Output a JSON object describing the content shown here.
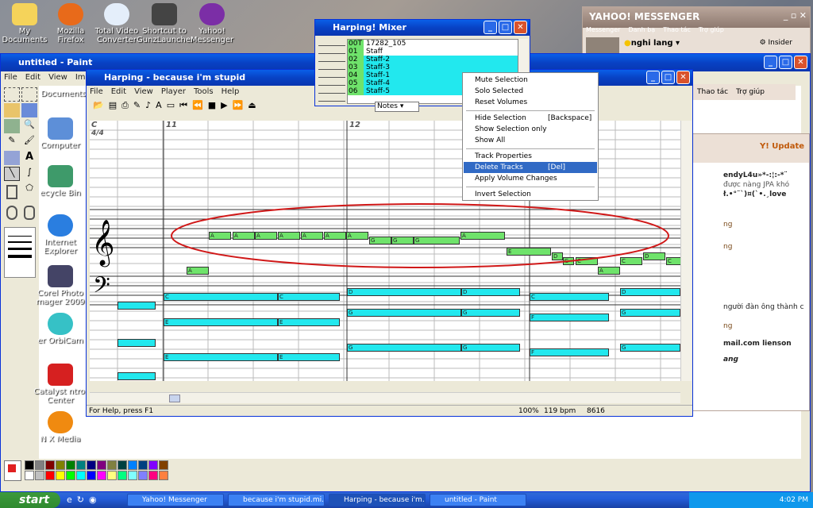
{
  "desktop_icons": [
    {
      "label": "My Documents"
    },
    {
      "label": "Mozilla Firefox"
    },
    {
      "label": "Total Video Converter"
    },
    {
      "label": "Shortcut to GunzLauncher"
    },
    {
      "label": "Yahoo! Messenger"
    }
  ],
  "left_icons": [
    {
      "label": "Documents"
    },
    {
      "label": "Computer"
    },
    {
      "label": "ecycle Bin"
    },
    {
      "label": "Internet Explorer"
    },
    {
      "label": "Corel Photo mager 2009"
    },
    {
      "label": "er OrbiCam"
    },
    {
      "label": "Catalyst ntrol Center"
    },
    {
      "label": "N X Media"
    }
  ],
  "paint": {
    "title": "untitled - Paint",
    "menu": [
      "File",
      "Edit",
      "View",
      "Image"
    ]
  },
  "harping": {
    "title": "Harping - because i'm stupid",
    "menu": [
      "File",
      "Edit",
      "View",
      "Player",
      "Tools",
      "Help"
    ],
    "measures": [
      "11",
      "12"
    ],
    "clef_label": "C",
    "time_sig": "4/4",
    "status": "For Help, press F1",
    "zoom": "100%",
    "bpm": "119 bpm",
    "pos": "8616",
    "notes_select": "Notes"
  },
  "mixer": {
    "title": "Harping! Mixer",
    "tracks": [
      {
        "num": "00T",
        "name": "17282_105"
      },
      {
        "num": "01",
        "name": "Staff"
      },
      {
        "num": "02",
        "name": "Staff-2"
      },
      {
        "num": "03",
        "name": "Staff-3"
      },
      {
        "num": "04",
        "name": "Staff-1"
      },
      {
        "num": "05",
        "name": "Staff-4"
      },
      {
        "num": "06",
        "name": "Staff-5"
      }
    ]
  },
  "context_menu": {
    "items": [
      {
        "label": "Mute Selection",
        "shortcut": ""
      },
      {
        "label": "Solo Selected",
        "shortcut": ""
      },
      {
        "label": "Reset Volumes",
        "shortcut": ""
      },
      {
        "label": "Hide Selection",
        "shortcut": "[Backspace]"
      },
      {
        "label": "Show Selection only",
        "shortcut": ""
      },
      {
        "label": "Show All",
        "shortcut": ""
      },
      {
        "label": "Track Properties",
        "shortcut": ""
      },
      {
        "label": "Delete Tracks",
        "shortcut": "[Del]"
      },
      {
        "label": "Apply Volume Changes",
        "shortcut": ""
      },
      {
        "label": "Invert Selection",
        "shortcut": ""
      }
    ]
  },
  "yahoo": {
    "title": "YAHOO! MESSENGER",
    "menu": [
      "Messenger",
      "Danh bạ",
      "Thao tác",
      "Trợ giúp"
    ],
    "status": "nghi lang",
    "insider": "Insider",
    "update": "Y! Update",
    "menu2": [
      "Thao tác",
      "Trợ giúp"
    ],
    "lines": [
      "endyL4u»*-:¦:-*¨",
      "được nàng JPA khó",
      "ł.•°¨`)¤(`•.¸love",
      "ng",
      "ng",
      "người đàn ông thành c",
      "ng",
      "mail.com lienson",
      "ang"
    ]
  },
  "taskbar": {
    "start": "start",
    "tasks": [
      "Yahoo! Messenger",
      "because i'm stupid.mi...",
      "Harping - because i'm...",
      "untitled - Paint"
    ],
    "clock": "4:02 PM"
  },
  "colors": {
    "accent": "#0a5fe8",
    "note_green": "#6fe36b",
    "note_cyan": "#22e8ee",
    "ellipse": "#d01818"
  }
}
